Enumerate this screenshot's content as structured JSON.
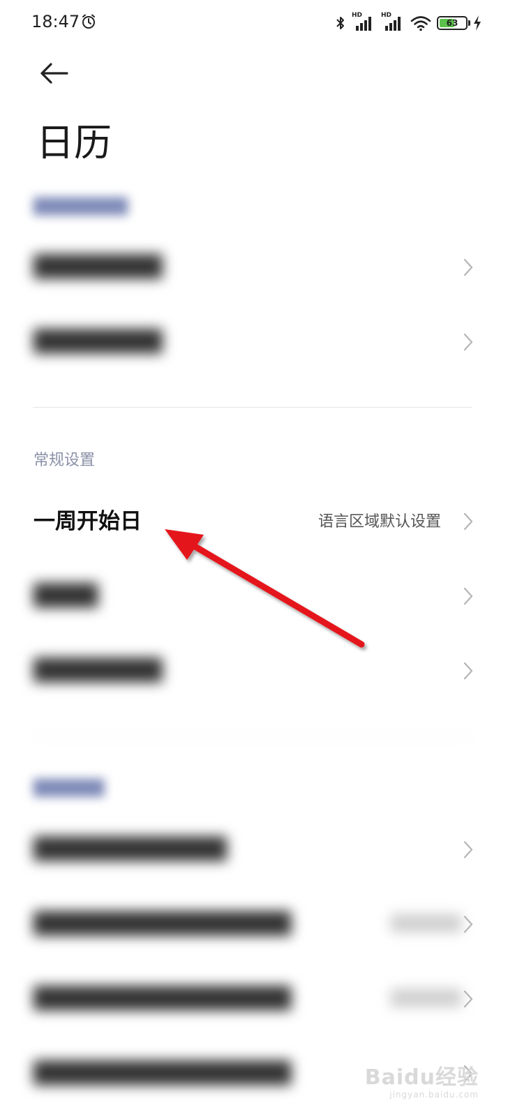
{
  "status_bar": {
    "time": "18:47",
    "battery_percent": "63",
    "battery_level": 0.63,
    "icons": [
      "alarm-icon",
      "bluetooth-icon",
      "hd-signal-icon",
      "hd-signal-icon",
      "wifi-icon",
      "battery-icon",
      "charging-icon"
    ]
  },
  "header": {
    "back_icon": "back-arrow-icon",
    "title": "日历"
  },
  "general_section": {
    "heading": "常规设置",
    "week_start": {
      "label": "一周开始日",
      "value": "语言区域默认设置"
    }
  },
  "watermark": {
    "text": "Baidu经验",
    "sub": "jingyan.baidu.com"
  },
  "annotation": {
    "type": "red-arrow",
    "color": "#e4161b"
  },
  "colors": {
    "section_heading": "#8a90a8",
    "chevron": "#b8b8b8",
    "battery_fill": "#5bc14b"
  }
}
